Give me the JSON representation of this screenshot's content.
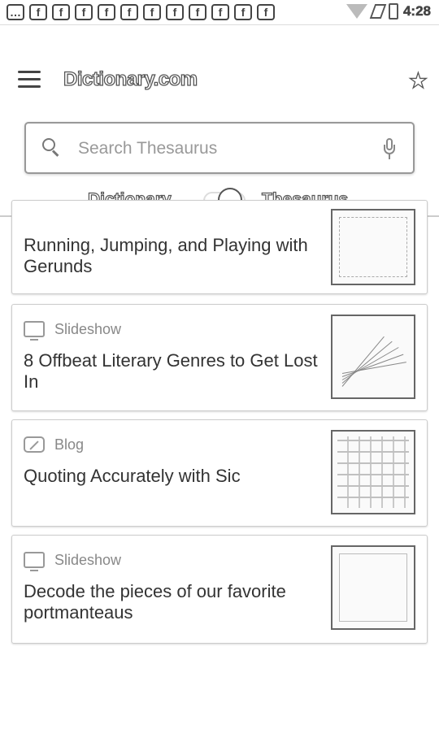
{
  "status_bar": {
    "notification_icons": [
      "…",
      "f",
      "f",
      "f",
      "f",
      "f",
      "f",
      "f",
      "f",
      "f",
      "f",
      "f"
    ],
    "time": "4:28"
  },
  "header": {
    "logo": "Dictionary.com",
    "search_placeholder": "Search Thesaurus",
    "toggle_left": "Dictionary",
    "toggle_right": "Thesaurus"
  },
  "cards": [
    {
      "type": "",
      "title": "Running, Jumping, and Playing with Gerunds",
      "icon": "slideshow-icon"
    },
    {
      "type": "Slideshow",
      "title": "8 Offbeat Literary Genres to Get Lost In",
      "icon": "slideshow-icon"
    },
    {
      "type": "Blog",
      "title": "Quoting Accurately with Sic",
      "icon": "blog-icon"
    },
    {
      "type": "Slideshow",
      "title": "Decode the pieces of our favorite portmanteaus",
      "icon": "slideshow-icon"
    }
  ]
}
